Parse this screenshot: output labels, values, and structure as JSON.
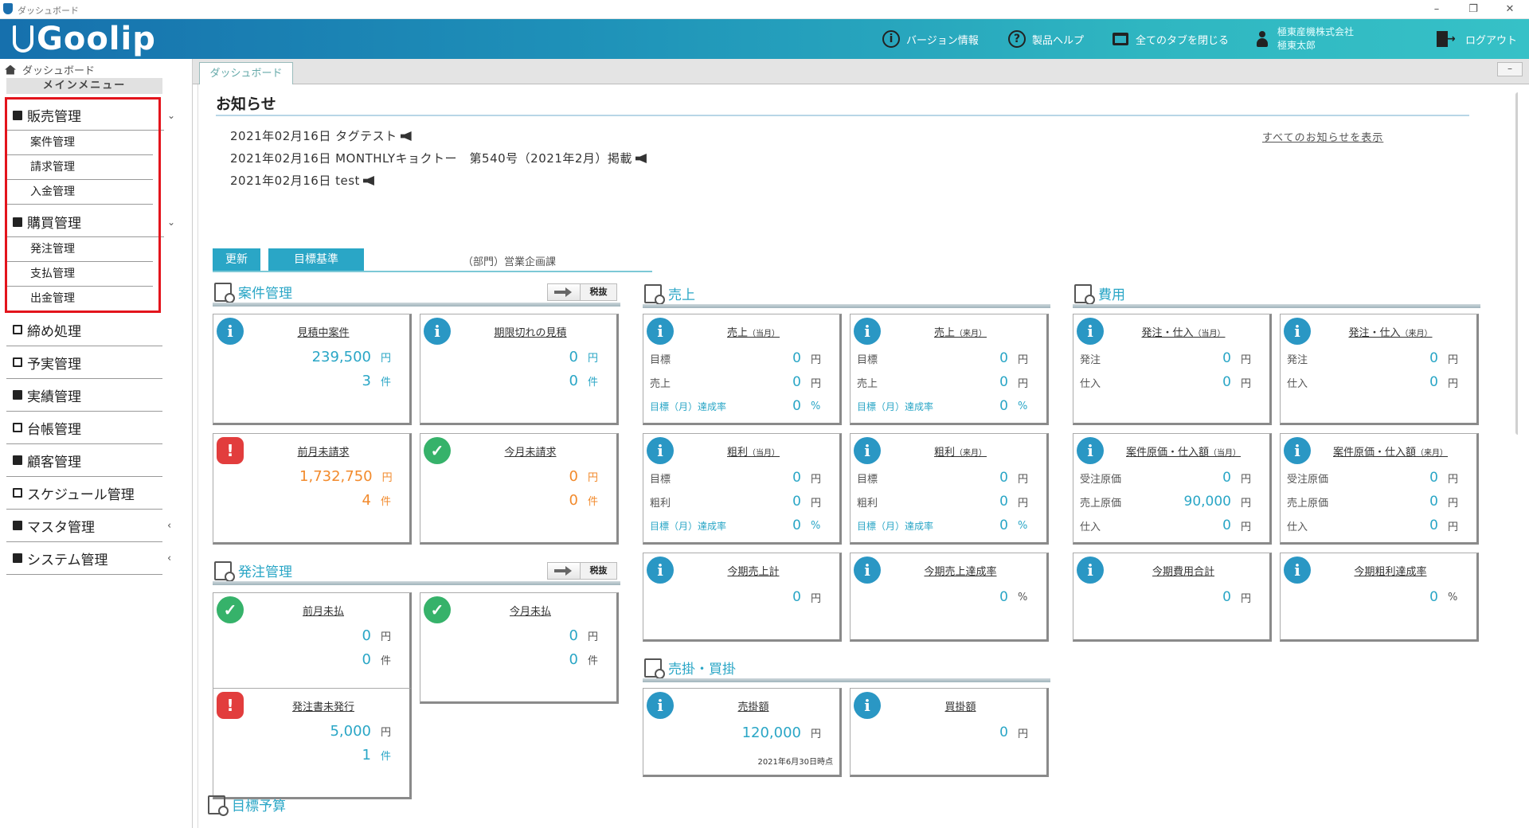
{
  "window": {
    "title": "ダッシュボード",
    "minimize": "–",
    "restore": "❐",
    "close": "✕"
  },
  "header": {
    "logo": "Goolip",
    "version_info": "バージョン情報",
    "help": "製品ヘルプ",
    "close_tabs": "全てのタブを閉じる",
    "company": "極東産機株式会社",
    "user": "極東太郎",
    "logout": "ログアウト"
  },
  "sidebar": {
    "dashboard": "ダッシュボード",
    "main_menu": "メインメニュー",
    "sales": {
      "label": "販売管理",
      "items": [
        "案件管理",
        "請求管理",
        "入金管理"
      ]
    },
    "purchase": {
      "label": "購買管理",
      "items": [
        "発注管理",
        "支払管理",
        "出金管理"
      ]
    },
    "items": [
      "締め処理",
      "予実管理",
      "実績管理",
      "台帳管理",
      "顧客管理",
      "スケジュール管理",
      "マスタ管理",
      "システム管理"
    ]
  },
  "tabs": {
    "active": "ダッシュボード",
    "minimize": "–"
  },
  "news": {
    "title": "お知らせ",
    "items": [
      "2021年02月16日 タグテスト",
      "2021年02月16日 MONTHLYキョクトー　第540号（2021年2月）掲載",
      "2021年02月16日 test"
    ],
    "show_all": "すべてのお知らせを表示"
  },
  "filters": {
    "refresh": "更新",
    "target": "目標基準",
    "dept": "（部門）営業企画課"
  },
  "sections": {
    "anken": "案件管理",
    "hatchu": "発注管理",
    "uriage": "売上",
    "hiyo": "費用",
    "urikake": "売掛・買掛",
    "mokuhyo": "目標予算",
    "tax_label": "税抜"
  },
  "cards": {
    "mitsumori": {
      "title": "見積中案件",
      "amount": "239,500",
      "count": "3"
    },
    "kigen": {
      "title": "期限切れの見積",
      "amount": "0",
      "count": "0"
    },
    "zengetsu_seikyu": {
      "title": "前月未請求",
      "amount": "1,732,750",
      "count": "4"
    },
    "kongetsu_seikyu": {
      "title": "今月未請求",
      "amount": "0",
      "count": "0"
    },
    "zengetsu_harai": {
      "title": "前月未払",
      "amount": "0",
      "count": "0"
    },
    "kongetsu_harai": {
      "title": "今月未払",
      "amount": "0",
      "count": "0"
    },
    "hatchusho": {
      "title": "発注書未発行",
      "amount": "5,000",
      "count": "1"
    },
    "uriage_cur": {
      "title": "売上",
      "sub": "（当月）",
      "target": "0",
      "actual": "0",
      "rate": "0"
    },
    "uriage_next": {
      "title": "売上",
      "sub": "（来月）",
      "target": "0",
      "actual": "0",
      "rate": "0"
    },
    "arari_cur": {
      "title": "粗利",
      "sub": "（当月）",
      "target": "0",
      "actual": "0",
      "rate": "0"
    },
    "arari_next": {
      "title": "粗利",
      "sub": "（来月）",
      "target": "0",
      "actual": "0",
      "rate": "0"
    },
    "kouki_uriage": {
      "title": "今期売上計",
      "value": "0"
    },
    "kouki_tassei": {
      "title": "今期売上達成率",
      "value": "0"
    },
    "hatchu_cur": {
      "title": "発注・仕入",
      "sub": "（当月）",
      "order": "0",
      "stock": "0"
    },
    "hatchu_next": {
      "title": "発注・仕入",
      "sub": "（来月）",
      "order": "0",
      "stock": "0"
    },
    "genka_cur": {
      "title": "案件原価・仕入額",
      "sub": "（当月）",
      "order_cost": "0",
      "sales_cost": "90,000",
      "stock": "0"
    },
    "genka_next": {
      "title": "案件原価・仕入額",
      "sub": "（来月）",
      "order_cost": "0",
      "sales_cost": "0",
      "stock": "0"
    },
    "kouki_hiyo": {
      "title": "今期費用合計",
      "value": "0"
    },
    "kouki_arari": {
      "title": "今期粗利達成率",
      "value": "0"
    },
    "urikake": {
      "title": "売掛額",
      "value": "120,000",
      "note": "2021年6月30日時点"
    },
    "kaikake": {
      "title": "買掛額",
      "value": "0"
    }
  },
  "labels": {
    "yen": "円",
    "ken": "件",
    "pct": "%",
    "target": "目標",
    "sales": "売上",
    "gross": "粗利",
    "rate": "目標（月）達成率",
    "order": "発注",
    "stock": "仕入",
    "order_cost": "受注原価",
    "sales_cost": "売上原価"
  }
}
